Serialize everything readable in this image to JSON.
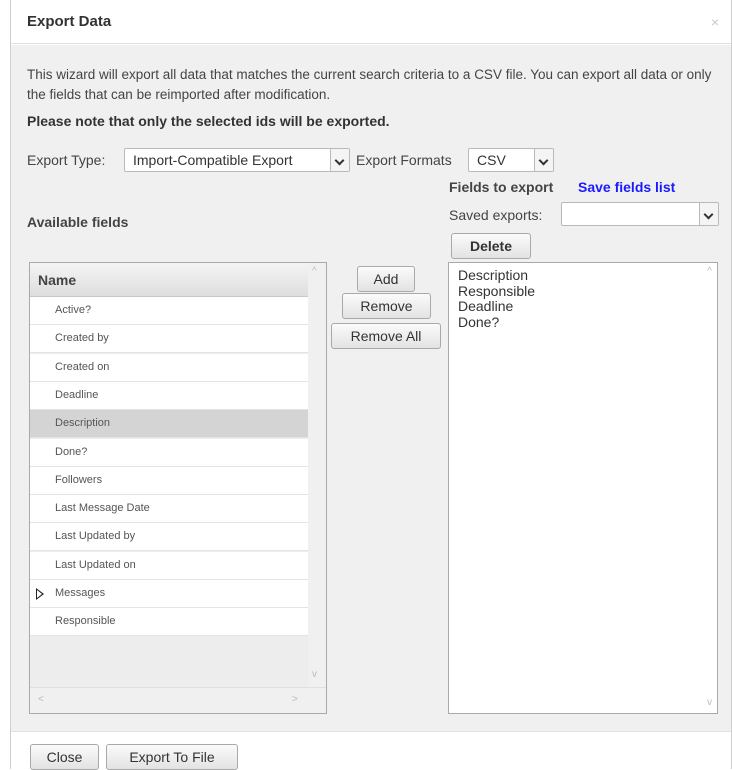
{
  "dialog": {
    "title": "Export Data",
    "close_glyph": "×"
  },
  "intro": {
    "text": "This wizard will export all data that matches the current search criteria to a CSV file. You can export all data or only the fields that can be reimported after modification.",
    "note": "Please note that only the selected ids will be exported."
  },
  "options": {
    "export_type_label": "Export Type:",
    "export_type_value": "Import-Compatible Export",
    "export_formats_label": "Export Formats",
    "export_formats_value": "CSV"
  },
  "export_panel": {
    "title": "Fields to export",
    "save_fields_link": "Save fields list",
    "saved_exports_label": "Saved exports:",
    "saved_exports_value": "",
    "delete_label": "Delete",
    "fields": [
      "Description",
      "Responsible",
      "Deadline",
      "Done?"
    ]
  },
  "available": {
    "title": "Available fields",
    "column_header": "Name",
    "fields": [
      {
        "label": "Active?"
      },
      {
        "label": "Created by"
      },
      {
        "label": "Created on"
      },
      {
        "label": "Deadline"
      },
      {
        "label": "Description",
        "selected": true
      },
      {
        "label": "Done?"
      },
      {
        "label": "Followers"
      },
      {
        "label": "Last Message Date"
      },
      {
        "label": "Last Updated by"
      },
      {
        "label": "Last Updated on"
      },
      {
        "label": "Messages",
        "expandable": true
      },
      {
        "label": "Responsible"
      }
    ]
  },
  "actions": {
    "add": "Add",
    "remove": "Remove",
    "remove_all": "Remove All"
  },
  "footer": {
    "close": "Close",
    "export": "Export To File"
  },
  "scroll": {
    "up": "^",
    "down": "v",
    "left": "<",
    "right": ">"
  }
}
